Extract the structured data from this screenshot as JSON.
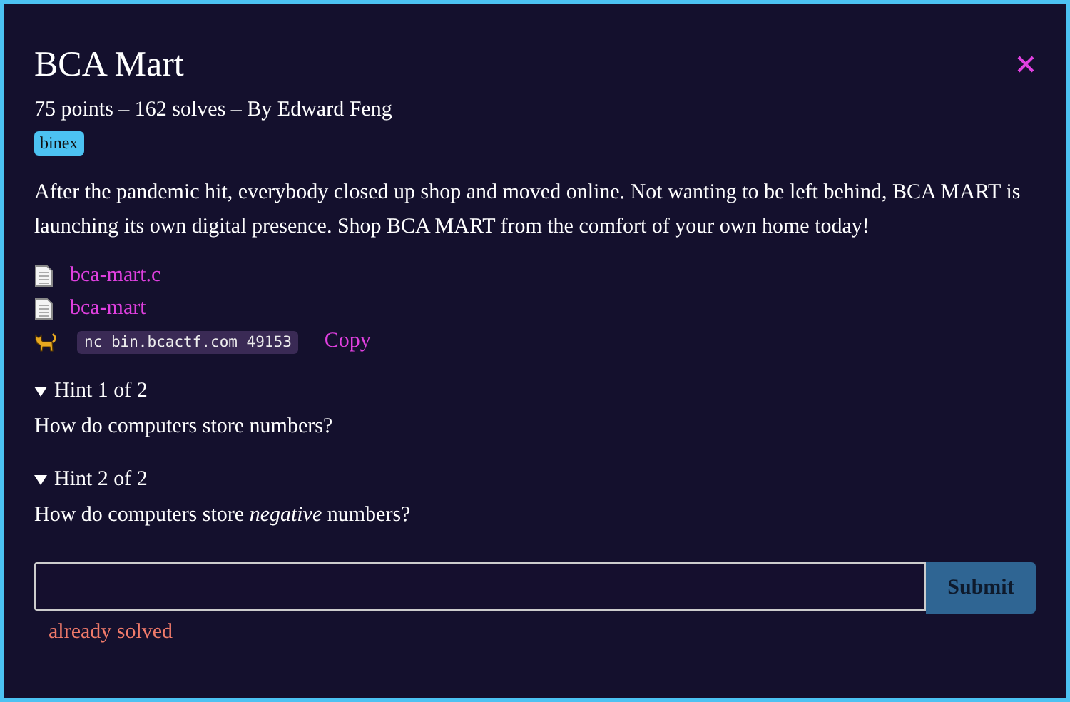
{
  "title": "BCA Mart",
  "meta": "75 points – 162 solves – By Edward Feng",
  "tags": [
    "binex"
  ],
  "description": "After the pandemic hit, everybody closed up shop and moved online. Not wanting to be left behind, BCA MART is launching its own digital presence. Shop BCA MART from the comfort of your own home today!",
  "files": [
    {
      "name": "bca-mart.c"
    },
    {
      "name": "bca-mart"
    }
  ],
  "connection": {
    "command": "nc bin.bcactf.com 49153",
    "copy": "Copy"
  },
  "hints": [
    {
      "label": "Hint 1 of 2",
      "expanded": true,
      "text": "How do computers store numbers?"
    },
    {
      "label": "Hint 2 of 2",
      "expanded": true,
      "text": "How do computers store *negative* numbers?"
    }
  ],
  "flag": {
    "button": "Submit",
    "status": "already solved"
  }
}
